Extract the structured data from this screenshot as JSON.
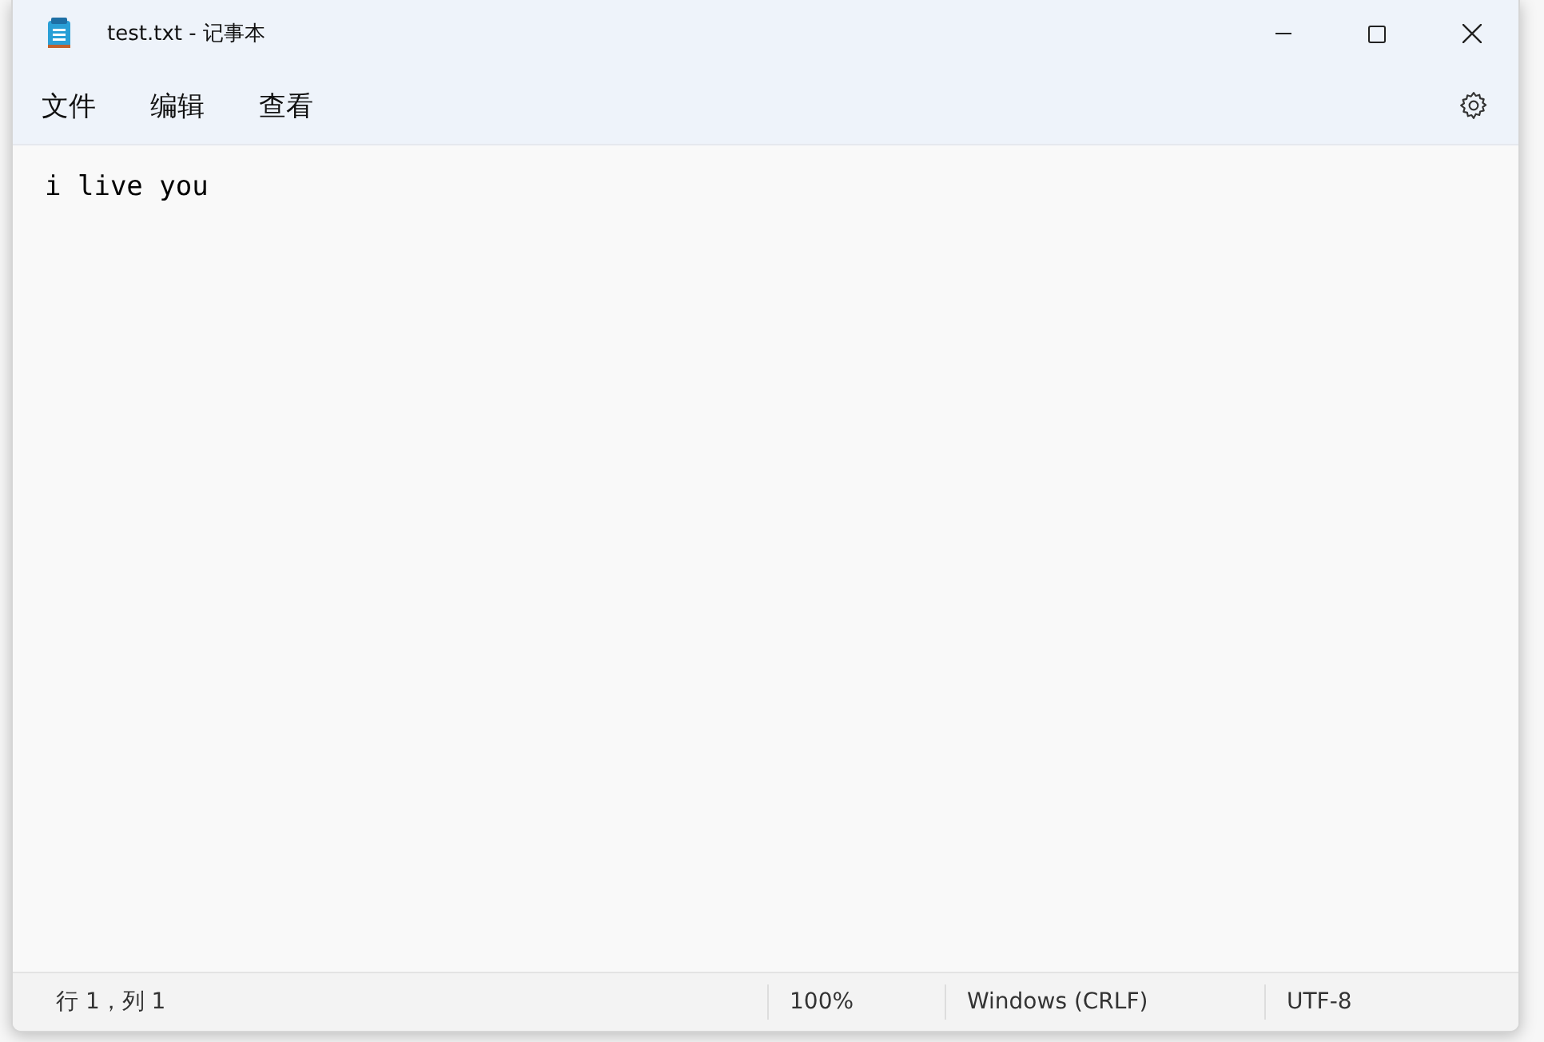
{
  "window": {
    "title": "test.txt - 记事本"
  },
  "menu": [
    {
      "label": "文件"
    },
    {
      "label": "编辑"
    },
    {
      "label": "查看"
    }
  ],
  "editor": {
    "value": "i live you"
  },
  "status_bar": [
    "行 1，列 1",
    "100%",
    "Windows (CRLF)",
    "UTF-8"
  ]
}
